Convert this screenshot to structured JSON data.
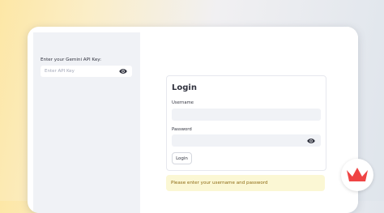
{
  "sidebar": {
    "api_key_label": "Enter your Gemini API Key:",
    "api_key_placeholder": "Enter API Key",
    "toggle_icon": "eye-icon"
  },
  "login_form": {
    "title": "Login",
    "username_label": "Username",
    "username_value": "",
    "password_label": "Password",
    "password_value": "",
    "password_toggle_icon": "eye-icon",
    "submit_label": "Login"
  },
  "alert": {
    "message": "Please enter your username and password",
    "background": "#fbf7d4",
    "text_color": "#8d6a13"
  },
  "logo": {
    "icon": "crown-logo",
    "color": "#ef4444"
  },
  "colors": {
    "sidebar_bg": "#f0f2f6",
    "input_bg": "#f0f2f6",
    "text": "#31333f"
  }
}
